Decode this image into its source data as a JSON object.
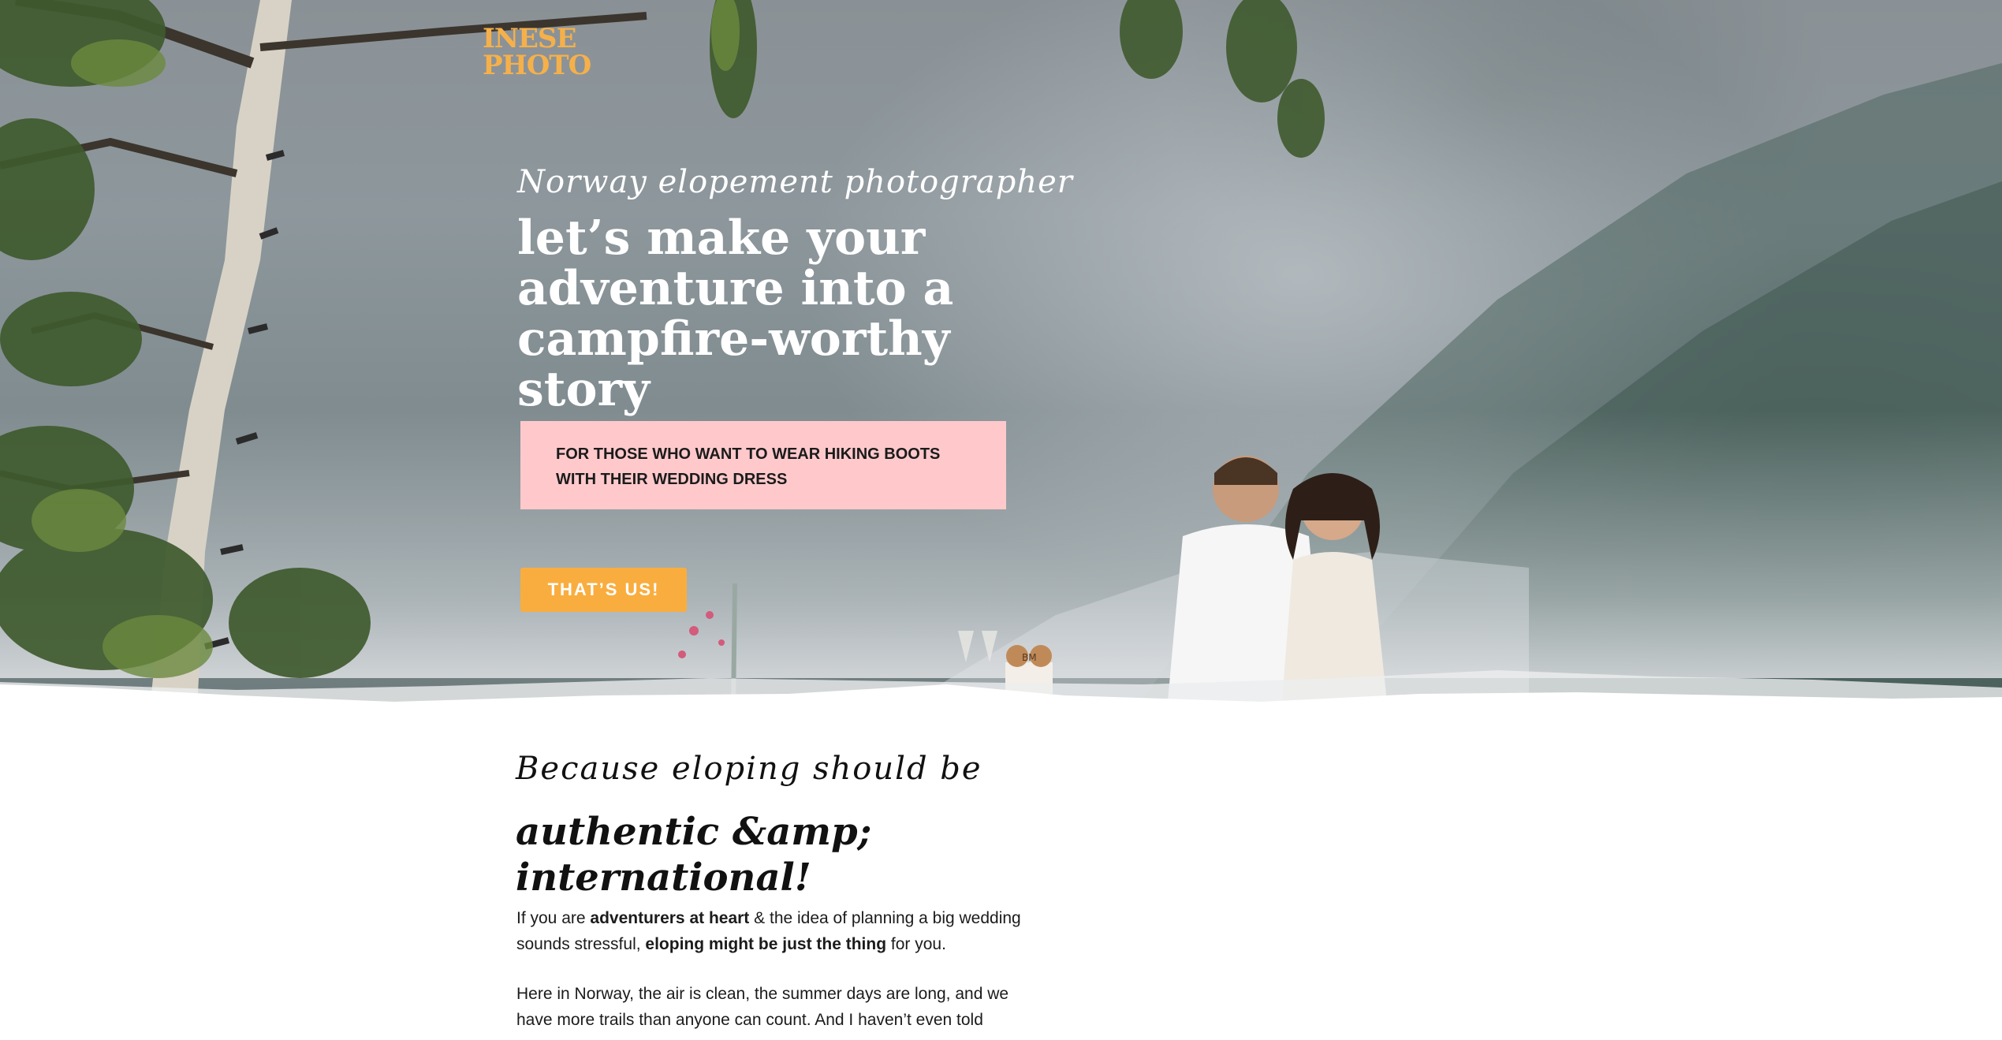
{
  "brand": {
    "logo_line1": "INESE",
    "logo_line2": "PHOTO",
    "accent": "#f6b04a",
    "pink": "#ffc9cc",
    "button": "#f9ad3f"
  },
  "hero": {
    "script": "Norway elopement photographer",
    "title": "let’s make your adventure into a campfire-worthy story",
    "box_text": "FOR THOSE WHO WANT TO WEAR HIKING BOOTS WITH THEIR WEDDING DRESS",
    "cta_label": "THAT’S US!",
    "cake_topper": "BM"
  },
  "intro": {
    "script": "Because eloping should be",
    "title": "authentic &amp; international!",
    "p1": {
      "t1": "If you are ",
      "b1": "adventurers at heart",
      "t2": " & the idea of planning a big wedding sounds stressful, ",
      "b2": "eloping might be just the thing",
      "t3": " for you."
    },
    "p2": "Here in Norway, the air is clean, the summer days are long, and we have more trails than anyone can count. And I haven’t even told"
  }
}
